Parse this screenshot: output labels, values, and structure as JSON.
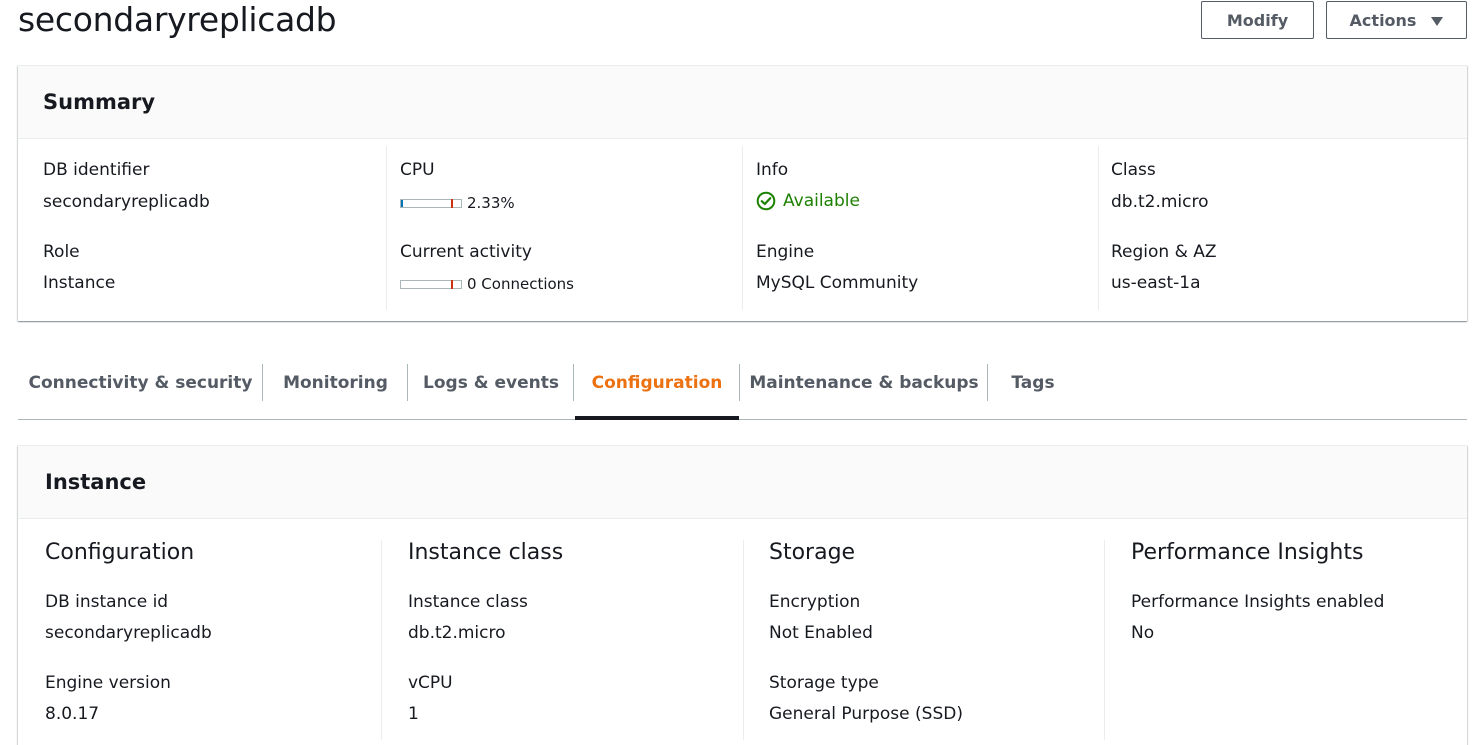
{
  "header": {
    "title": "secondaryreplicadb",
    "modify_label": "Modify",
    "actions_label": "Actions",
    "actions_icon": "caret-down-icon"
  },
  "summary": {
    "title": "Summary",
    "db_identifier": {
      "label": "DB identifier",
      "value": "secondaryreplicadb"
    },
    "role": {
      "label": "Role",
      "value": "Instance"
    },
    "cpu": {
      "label": "CPU",
      "value": "2.33%",
      "fill_percent": 2.33
    },
    "current_activity": {
      "label": "Current activity",
      "value": "0 Connections",
      "fill_percent": 0
    },
    "info": {
      "label": "Info",
      "value": "Available",
      "icon": "check-circle-icon",
      "color": "#1d8102"
    },
    "engine": {
      "label": "Engine",
      "value": "MySQL Community"
    },
    "class": {
      "label": "Class",
      "value": "db.t2.micro"
    },
    "region_az": {
      "label": "Region & AZ",
      "value": "us-east-1a"
    }
  },
  "tabs": [
    {
      "label": "Connectivity & security",
      "active": false
    },
    {
      "label": "Monitoring",
      "active": false
    },
    {
      "label": "Logs & events",
      "active": false
    },
    {
      "label": "Configuration",
      "active": true
    },
    {
      "label": "Maintenance & backups",
      "active": false
    },
    {
      "label": "Tags",
      "active": false
    }
  ],
  "instance": {
    "title": "Instance",
    "configuration": {
      "title": "Configuration",
      "db_instance_id": {
        "label": "DB instance id",
        "value": "secondaryreplicadb"
      },
      "engine_version": {
        "label": "Engine version",
        "value": "8.0.17"
      }
    },
    "instance_class": {
      "title": "Instance class",
      "instance_class": {
        "label": "Instance class",
        "value": "db.t2.micro"
      },
      "vcpu": {
        "label": "vCPU",
        "value": "1"
      }
    },
    "storage": {
      "title": "Storage",
      "encryption": {
        "label": "Encryption",
        "value": "Not Enabled"
      },
      "storage_type": {
        "label": "Storage type",
        "value": "General Purpose (SSD)"
      }
    },
    "performance_insights": {
      "title": "Performance Insights",
      "enabled": {
        "label": "Performance Insights enabled",
        "value": "No"
      }
    }
  },
  "colors": {
    "accent_active_tab": "#ec7211",
    "success": "#1d8102",
    "meter_fill": "#0073bb",
    "meter_threshold": "#d13212"
  }
}
